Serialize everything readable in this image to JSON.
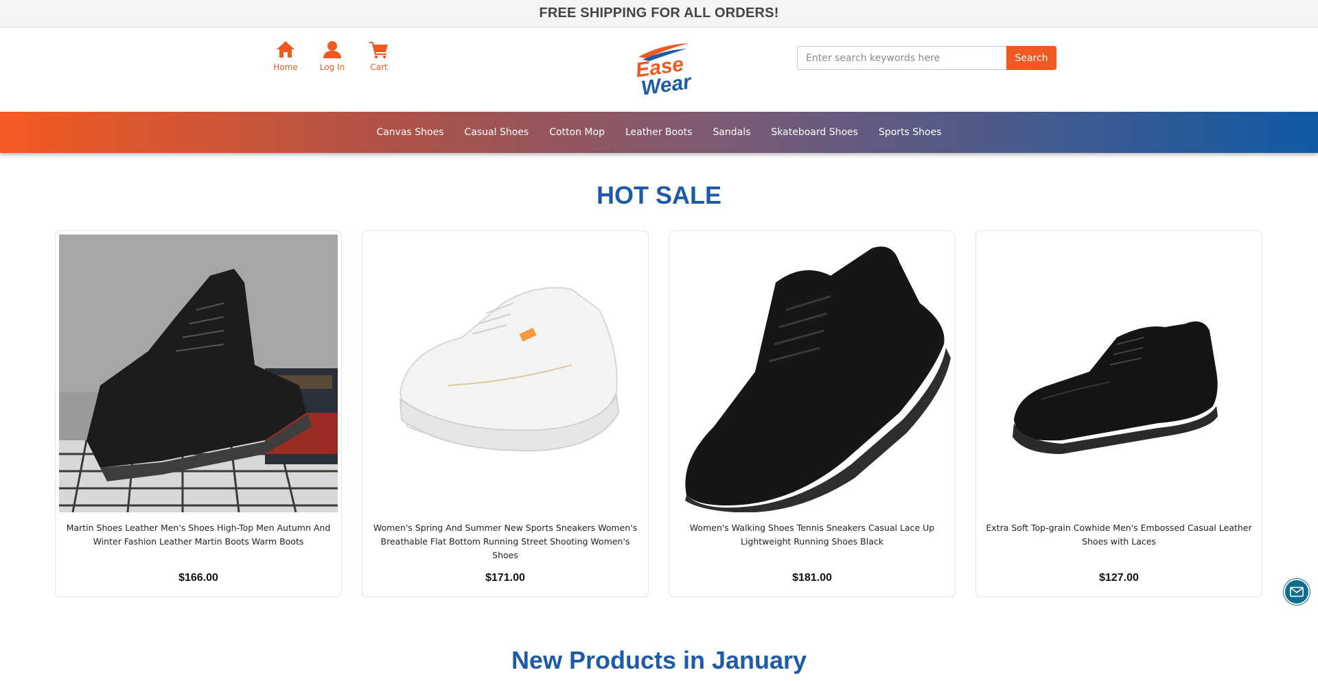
{
  "banner": {
    "text": "FREE SHIPPING FOR ALL ORDERS!"
  },
  "quick_links": [
    {
      "label": "Home",
      "icon": "home-icon"
    },
    {
      "label": "Log In",
      "icon": "user-icon"
    },
    {
      "label": "Cart",
      "icon": "cart-icon"
    }
  ],
  "logo": {
    "line1": "Ease",
    "line2": "Wear"
  },
  "search": {
    "placeholder": "Enter search keywords here",
    "value": "",
    "button_label": "Search"
  },
  "nav": {
    "items": [
      "Canvas Shoes",
      "Casual Shoes",
      "Cotton Mop",
      "Leather Boots",
      "Sandals",
      "Skateboard Shoes",
      "Sports Shoes"
    ]
  },
  "hot_sale": {
    "title": "HOT SALE",
    "products": [
      {
        "name": "Martin Shoes Leather Men's Shoes High-Top Men Autumn And Winter Fashion Leather Martin Boots Warm Boots",
        "price": "$166.00",
        "image": "black-suede-martin-boot"
      },
      {
        "name": "Women's Spring And Summer New Sports Sneakers Women's Breathable Flat Bottom Running Street Shooting Women's Shoes",
        "price": "$171.00",
        "image": "white-chunky-sneaker"
      },
      {
        "name": "Women's Walking Shoes Tennis Sneakers Casual Lace Up Lightweight Running Shoes Black",
        "price": "$181.00",
        "image": "black-knit-running-shoe"
      },
      {
        "name": "Extra Soft Top-grain Cowhide Men's Embossed Casual Leather Shoes with Laces",
        "price": "$127.00",
        "image": "black-leather-casual-shoe"
      }
    ]
  },
  "new_products": {
    "title": "New Products in January"
  },
  "colors": {
    "accent": "#f05a22",
    "heading": "#1d5aa7",
    "nav_start": "#f45a22",
    "nav_end": "#0f5aa4",
    "mail": "#0e6d8e"
  },
  "floating": {
    "icon": "mail-icon"
  }
}
